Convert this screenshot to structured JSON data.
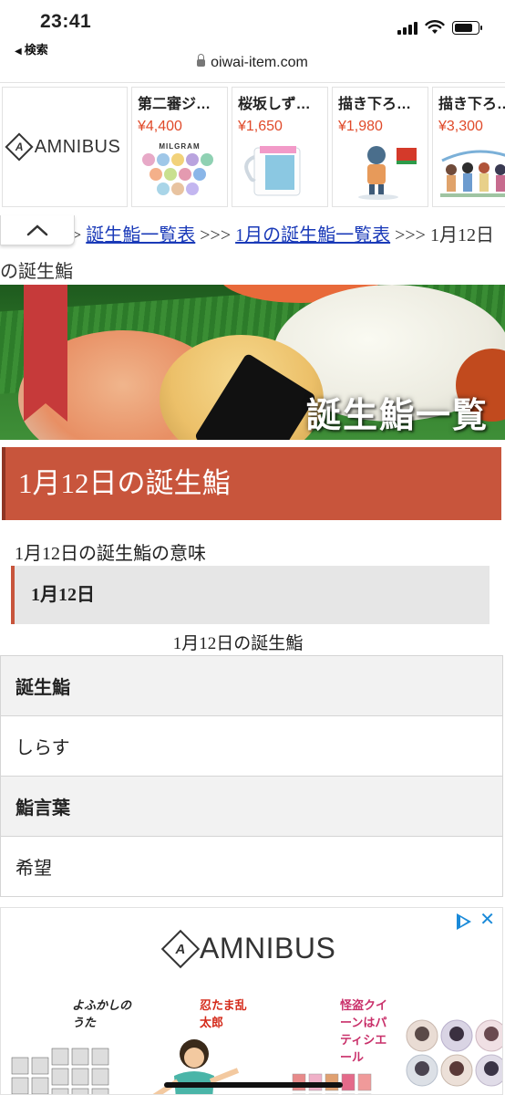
{
  "status_bar": {
    "time": "23:41",
    "back_label": "検索",
    "url": "oiwai-item.com"
  },
  "top_ad": {
    "brand": "AMNIBUS",
    "products": [
      {
        "title": "第二審ジ…",
        "price": "¥4,400"
      },
      {
        "title": "桜坂しず…",
        "price": "¥1,650"
      },
      {
        "title": "描き下ろ…",
        "price": "¥1,980"
      },
      {
        "title": "描き下ろ…",
        "price": "¥3,300"
      }
    ],
    "product_image_text": "MILGRAM"
  },
  "breadcrumb": {
    "sep1": ">",
    "link1": "誕生鮨一覧表",
    "sep2": ">>>",
    "link2": "1月の誕生鮨一覧表",
    "sep3": ">>>",
    "current": "1月12日の誕生鮨"
  },
  "hero": {
    "overlay_text": "誕生鮨一覧"
  },
  "page": {
    "title": "1月12日の誕生鮨",
    "meaning_heading": "1月12日の誕生鮨の意味",
    "date_label": "1月12日",
    "table_caption": "1月12日の誕生鮨"
  },
  "table": {
    "rows": [
      {
        "header": "誕生鮨",
        "value": "しらす"
      },
      {
        "header": "鮨言葉",
        "value": "希望"
      }
    ]
  },
  "bottom_ad": {
    "brand": "AMNIBUS",
    "promo1": "よふかしのうた",
    "promo2": "忍たま乱太郎",
    "promo3": "怪盗クイーンはパティシエール"
  },
  "colors": {
    "accent": "#c8553c",
    "link": "#1a3ab8",
    "price": "#e04a2a",
    "ad_blue": "#1a8ad9"
  }
}
